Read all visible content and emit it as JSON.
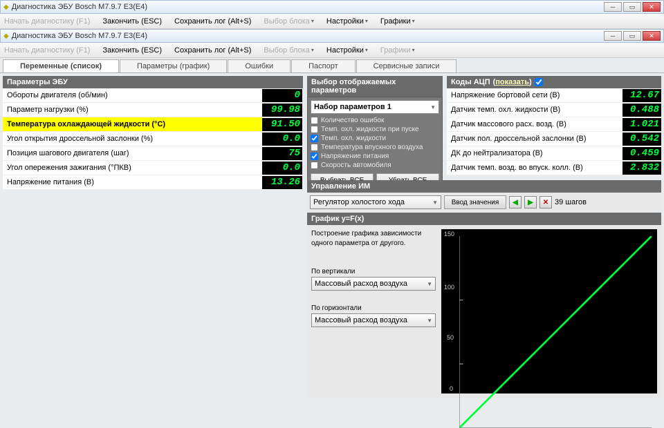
{
  "window": {
    "title": "Диагностика ЭБУ Bosch M7.9.7 E3(E4)"
  },
  "menu": {
    "start": "Начать диагностику (F1)",
    "finish": "Закончить (ESC)",
    "save": "Сохранить лог (Alt+S)",
    "block": "Выбор блока",
    "settings": "Настройки",
    "charts": "Графики"
  },
  "tabs": [
    "Переменные (список)",
    "Параметры (график)",
    "Ошибки",
    "Паспорт",
    "Сервисные записи"
  ],
  "ecu": {
    "header": "Параметры ЭБУ",
    "rows": [
      {
        "label": "Обороты двигателя (об/мин)",
        "value": "0"
      },
      {
        "label": "Параметр нагрузки (%)",
        "value": "99.98"
      },
      {
        "label": "Температура охлаждающей жидкости (°C)",
        "value": "91.50",
        "hi": true
      },
      {
        "label": "Угол открытия дроссельной заслонки (%)",
        "value": "0.0"
      },
      {
        "label": "Позиция шагового двигателя (шаг)",
        "value": "75"
      },
      {
        "label": "Угол опережения зажигания (°ПКВ)",
        "value": "0.0"
      },
      {
        "label": "Напряжение питания (В)",
        "value": "13.26"
      }
    ]
  },
  "display": {
    "header": "Выбор отображаемых параметров",
    "set": "Набор параметров 1",
    "items": [
      "Количество ошибок",
      "Темп. охл. жидкости при пуске",
      "Темп. охл. жидкости",
      "Температура впускного воздуха",
      "Напряжение питания",
      "Скорость автомобиля"
    ],
    "selectAll": "Выбрать ВСЕ",
    "clearAll": "Убрать ВСЕ"
  },
  "im": {
    "header": "Управление ИМ",
    "item": "Регулятор холостого хода",
    "enter": "Ввод значения",
    "steps": "39 шагов"
  },
  "adc": {
    "header": "Коды АЦП",
    "show": "показать",
    "rows": [
      {
        "label": "Напряжение бортовой сети (В)",
        "value": "12.67"
      },
      {
        "label": "Датчик темп. охл. жидкости (В)",
        "value": "0.488"
      },
      {
        "label": "Датчик массового расх. возд. (В)",
        "value": "1.021"
      },
      {
        "label": "Датчик пол. дроссельной заслонки (В)",
        "value": "0.542"
      },
      {
        "label": "ДК до нейтрализатора (В)",
        "value": "0.459"
      },
      {
        "label": "Датчик темп. возд. во впуск. колл. (В)",
        "value": "2.832"
      }
    ]
  },
  "graph": {
    "header": "График y=F(x)",
    "desc": "Построение графика зависимости одного параметра от другого.",
    "vert": "По вертикали",
    "horiz": "По горизонтали",
    "option": "Массовый расход воздуха"
  },
  "chart_data": {
    "type": "line",
    "title": "",
    "xlabel": "",
    "ylabel": "",
    "ylim": [
      0,
      150
    ],
    "x": [
      0,
      150
    ],
    "series": [
      {
        "name": "y=F(x)",
        "values": [
          0,
          150
        ]
      }
    ],
    "y_ticks": [
      0,
      50,
      100,
      150
    ]
  }
}
